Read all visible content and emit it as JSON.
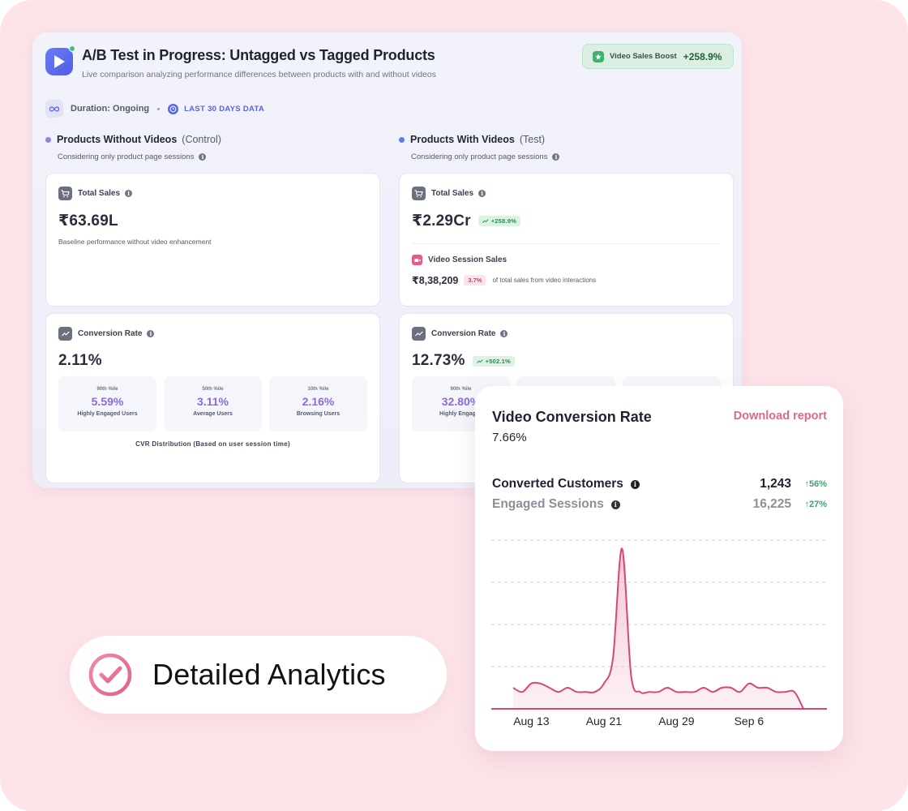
{
  "dashboard": {
    "title": "A/B Test in Progress: Untagged vs Tagged Products",
    "subtitle": "Live comparison analyzing performance differences between products with and without videos",
    "boost": {
      "label": "Video Sales Boost",
      "value": "+258.9%"
    },
    "duration": "Duration: Ongoing",
    "range": "LAST 30 DAYS DATA",
    "control": {
      "title": "Products Without Videos",
      "tag": "(Control)",
      "note": "Considering only product page sessions",
      "sales": {
        "label": "Total Sales",
        "value": "₹63.69L",
        "note": "Baseline performance without video enhancement"
      },
      "cvr": {
        "label": "Conversion Rate",
        "value": "2.11%",
        "caption": "CVR Distribution (Based on user session time)",
        "boxes": [
          {
            "key": "90th %ile",
            "value": "5.59%",
            "desc": "Highly Engaged Users"
          },
          {
            "key": "50th %ile",
            "value": "3.11%",
            "desc": "Average Users"
          },
          {
            "key": "10th %ile",
            "value": "2.16%",
            "desc": "Browsing Users"
          }
        ]
      }
    },
    "test": {
      "title": "Products With Videos",
      "tag": "(Test)",
      "note": "Considering only product page sessions",
      "sales": {
        "label": "Total Sales",
        "value": "₹2.29Cr",
        "change": "+258.9%",
        "video_label": "Video Session Sales",
        "video_value": "₹8,38,209",
        "video_share": "3.7%",
        "video_note": "of total sales from video interactions"
      },
      "cvr": {
        "label": "Conversion Rate",
        "value": "12.73%",
        "change": "+502.1%",
        "boxes": [
          {
            "key": "90th %ile",
            "value": "32.80%",
            "desc": "Highly Engaged"
          }
        ]
      }
    }
  },
  "feature_pill": {
    "label": "Detailed Analytics",
    "icon": "check-circle-icon"
  },
  "chart_card": {
    "title": "Video Conversion Rate",
    "value": "7.66%",
    "download": "Download report",
    "metrics": [
      {
        "name": "Converted Customers",
        "value": "1,243",
        "change": "56%"
      },
      {
        "name": "Engaged Sessions",
        "value": "16,225",
        "change": "27%"
      }
    ]
  },
  "chart_data": {
    "type": "area",
    "title": "",
    "xlabel": "",
    "ylabel": "",
    "x_ticks": [
      "Aug 13",
      "Aug 21",
      "Aug 29",
      "Sep 6"
    ],
    "x": [
      "Aug 11",
      "Aug 12",
      "Aug 13",
      "Aug 14",
      "Aug 15",
      "Aug 16",
      "Aug 17",
      "Aug 18",
      "Aug 19",
      "Aug 20",
      "Aug 21",
      "Aug 22",
      "Aug 23",
      "Aug 24",
      "Aug 25",
      "Aug 26",
      "Aug 27",
      "Aug 28",
      "Aug 29",
      "Aug 30",
      "Aug 31",
      "Sep 1",
      "Sep 2",
      "Sep 3",
      "Sep 4",
      "Sep 5",
      "Sep 6",
      "Sep 7",
      "Sep 8",
      "Sep 9",
      "Sep 10",
      "Sep 11",
      "Sep 12"
    ],
    "values": [
      0.5,
      0.4,
      0.6,
      0.6,
      0.5,
      0.4,
      0.5,
      0.4,
      0.4,
      0.4,
      0.6,
      1.2,
      3.8,
      0.8,
      0.4,
      0.4,
      0.4,
      0.5,
      0.4,
      0.4,
      0.4,
      0.5,
      0.4,
      0.5,
      0.5,
      0.4,
      0.6,
      0.5,
      0.5,
      0.4,
      0.4,
      0.4,
      0.0
    ],
    "ylim": [
      0,
      4
    ],
    "grid": true,
    "color": "#d8457a",
    "fill": "#f6c6d6"
  }
}
